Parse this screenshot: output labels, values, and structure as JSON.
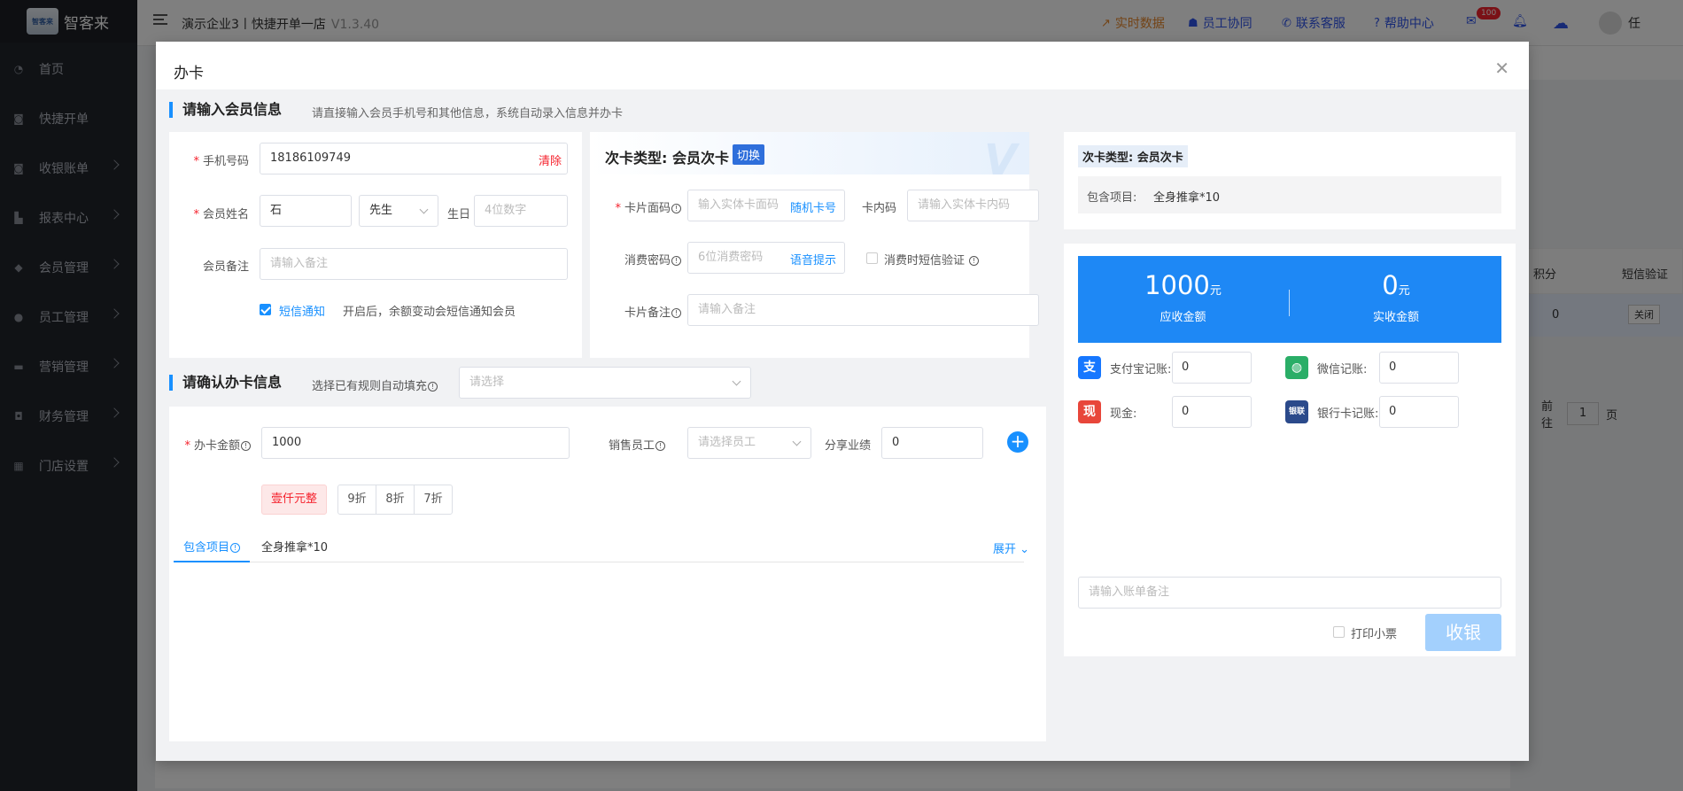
{
  "app": {
    "logo_text": "智客来",
    "logo_mark": "智客来",
    "company": "演示企业3丨快捷开单一店",
    "version": "V1.3.40"
  },
  "sidebar": {
    "items": [
      {
        "label": "首页",
        "icon": "dashboard-icon"
      },
      {
        "label": "快捷开单",
        "icon": "bag-icon"
      },
      {
        "label": "收银账单",
        "icon": "bag-icon"
      },
      {
        "label": "报表中心",
        "icon": "bar-chart-icon"
      },
      {
        "label": "会员管理",
        "icon": "diamond-icon"
      },
      {
        "label": "员工管理",
        "icon": "user-icon"
      },
      {
        "label": "营销管理",
        "icon": "briefcase-icon"
      },
      {
        "label": "财务管理",
        "icon": "finance-icon"
      },
      {
        "label": "门店设置",
        "icon": "grid-icon"
      }
    ]
  },
  "topbar": {
    "realtime": "实时数据",
    "staff": "员工协同",
    "service": "联系客服",
    "help": "帮助中心",
    "mail_badge": "100",
    "user": "任"
  },
  "background_page": {
    "col_points": "积分",
    "col_sms": "短信验证",
    "cell_points": "0",
    "cell_sms_btn": "关闭",
    "goto_label": "前往",
    "goto_page": "1",
    "page_unit": "页"
  },
  "modal": {
    "title": "办卡",
    "member_section": {
      "title": "请输入会员信息",
      "hint": "请直接输入会员手机号和其他信息，系统自动录入信息并办卡",
      "phone_label": "手机号码",
      "phone_value": "18186109749",
      "clear_label": "清除",
      "name_label": "会员姓名",
      "name_value": "石",
      "gender_value": "先生",
      "birthday_label": "生日",
      "birthday_placeholder": "4位数字",
      "remark_label": "会员备注",
      "remark_placeholder": "请输入备注",
      "sms_checkbox_label": "短信通知",
      "sms_hint": "开启后，余额变动会短信通知会员"
    },
    "card_type_section": {
      "title": "次卡类型: 会员次卡",
      "switch_label": "切换",
      "face_no_label": "卡片面码",
      "face_no_placeholder": "输入实体卡面码",
      "random_label": "随机卡号",
      "inner_no_label": "卡内码",
      "inner_no_placeholder": "请输入实体卡内码",
      "pwd_label": "消费密码",
      "pwd_placeholder": "6位消费密码",
      "voice_label": "语音提示",
      "sms_verify_label": "消费时短信验证",
      "card_remark_label": "卡片备注",
      "card_remark_placeholder": "请输入备注"
    },
    "confirm_section": {
      "title": "请确认办卡信息",
      "rule_label": "选择已有规则自动填充",
      "rule_placeholder": "请选择",
      "amount_label": "办卡金额",
      "amount_value": "1000",
      "staff_label": "销售员工",
      "staff_placeholder": "请选择员工",
      "share_label": "分享业绩",
      "share_value": "0",
      "amount_cn": "壹仟元整",
      "discounts": [
        "9折",
        "8折",
        "7折"
      ],
      "tab_label": "包含项目",
      "tab_content": "全身推拿*10",
      "expand_label": "展开"
    },
    "summary": {
      "type_tag": "次卡类型: 会员次卡",
      "items_label": "包含项目:",
      "items_value": "全身推拿*10"
    },
    "checkout": {
      "receivable_amount": "1000",
      "receivable_unit": "元",
      "receivable_label": "应收金额",
      "received_amount": "0",
      "received_unit": "元",
      "received_label": "实收金额",
      "alipay_label": "支付宝记账:",
      "alipay_value": "0",
      "wechat_label": "微信记账:",
      "wechat_value": "0",
      "cash_label": "现金:",
      "cash_value": "0",
      "bank_label": "银行卡记账:",
      "bank_value": "0",
      "bill_remark_placeholder": "请输入账单备注",
      "print_label": "打印小票",
      "submit_label": "收银"
    }
  },
  "colors": {
    "primary": "#1890ff",
    "sidebar_bg": "#20242b",
    "danger": "#f5222d",
    "alipay": "#1677ff",
    "wechat": "#2aae67",
    "cash": "#e8463a",
    "bank": "#2b4a8b"
  }
}
